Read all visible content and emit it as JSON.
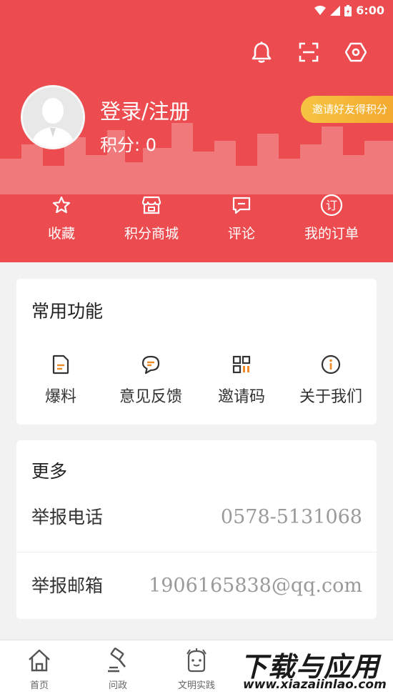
{
  "status_bar": {
    "time": "6:00"
  },
  "profile": {
    "login_label": "登录/注册",
    "points_label": "积分: 0",
    "invite_badge": "邀请好友得积分"
  },
  "quick_nav": [
    {
      "label": "收藏",
      "icon": "star-icon"
    },
    {
      "label": "积分商城",
      "icon": "shop-icon"
    },
    {
      "label": "评论",
      "icon": "comment-icon"
    },
    {
      "label": "我的订单",
      "icon": "order-icon"
    }
  ],
  "common_functions": {
    "title": "常用功能",
    "items": [
      {
        "label": "爆料",
        "icon": "tipoff-icon"
      },
      {
        "label": "意见反馈",
        "icon": "feedback-icon"
      },
      {
        "label": "邀请码",
        "icon": "qr-code-icon"
      },
      {
        "label": "关于我们",
        "icon": "info-icon"
      }
    ]
  },
  "more": {
    "title": "更多",
    "rows": [
      {
        "label": "举报电话",
        "value": "0578-5131068"
      },
      {
        "label": "举报邮箱",
        "value": "1906165838@qq.com"
      }
    ]
  },
  "tabbar": [
    {
      "label": "首页",
      "icon": "home-icon"
    },
    {
      "label": "问政",
      "icon": "gavel-icon"
    },
    {
      "label": "文明实践",
      "icon": "civilization-icon"
    }
  ],
  "watermark": {
    "main": "下载与应用",
    "sub": "www.xiazaiinlao.com"
  },
  "colors": {
    "primary": "#ec4c4f",
    "accent": "#f08a24",
    "badge": "#f3b23a"
  }
}
